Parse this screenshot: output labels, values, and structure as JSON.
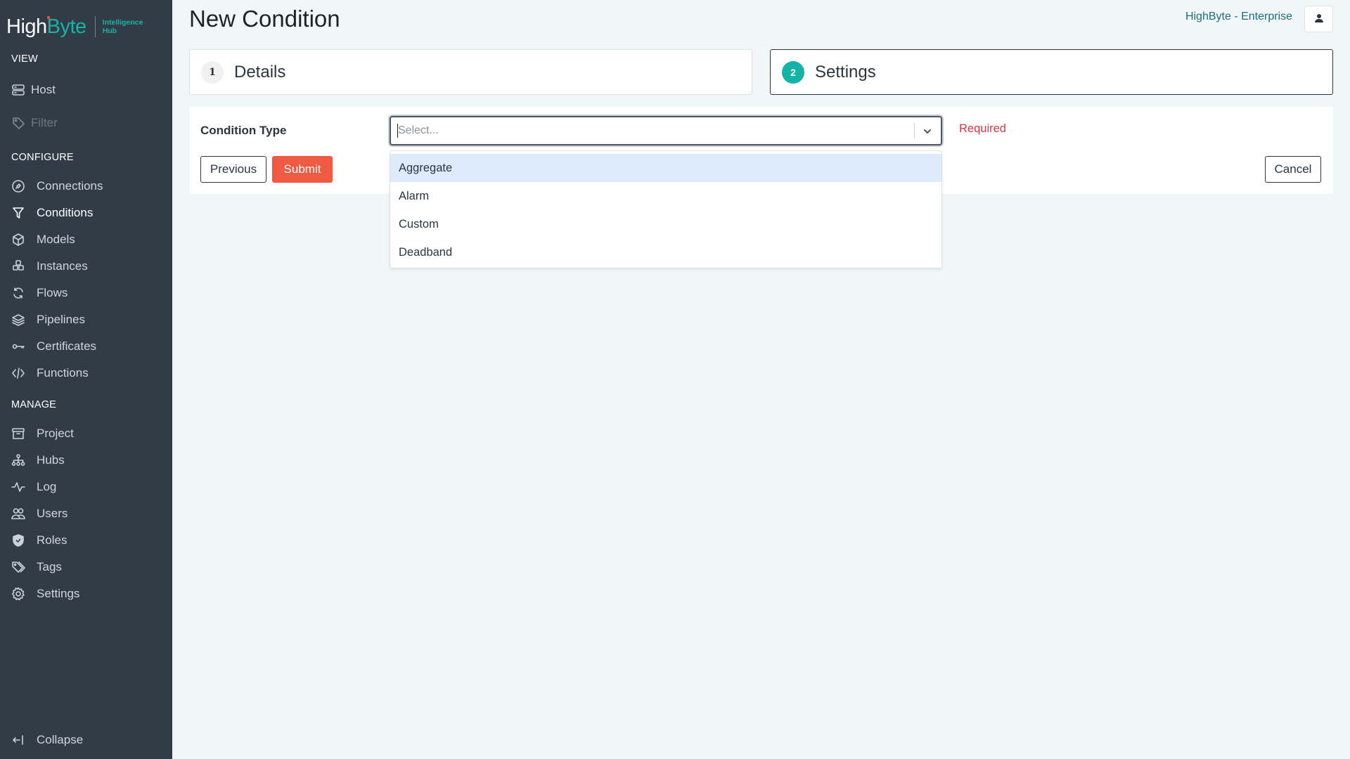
{
  "logo": {
    "brand_high": "High",
    "brand_byte": "Byte",
    "sub_line1": "Intelligence",
    "sub_line2": "Hub"
  },
  "sidebar": {
    "view_title": "VIEW",
    "view_items": [
      {
        "label": "Host",
        "icon": "server-icon"
      },
      {
        "label": "Filter",
        "icon": "tag-icon",
        "disabled": true
      }
    ],
    "configure_title": "CONFIGURE",
    "configure_items": [
      {
        "label": "Connections",
        "icon": "plug-icon"
      },
      {
        "label": "Conditions",
        "icon": "filter-icon",
        "active": true
      },
      {
        "label": "Models",
        "icon": "cube-icon"
      },
      {
        "label": "Instances",
        "icon": "cubes-icon"
      },
      {
        "label": "Flows",
        "icon": "refresh-icon"
      },
      {
        "label": "Pipelines",
        "icon": "layers-icon"
      },
      {
        "label": "Certificates",
        "icon": "key-icon"
      },
      {
        "label": "Functions",
        "icon": "code-icon"
      }
    ],
    "manage_title": "MANAGE",
    "manage_items": [
      {
        "label": "Project",
        "icon": "archive-icon"
      },
      {
        "label": "Hubs",
        "icon": "sitemap-icon"
      },
      {
        "label": "Log",
        "icon": "activity-icon"
      },
      {
        "label": "Users",
        "icon": "users-icon"
      },
      {
        "label": "Roles",
        "icon": "shield-icon"
      },
      {
        "label": "Tags",
        "icon": "tags-icon"
      },
      {
        "label": "Settings",
        "icon": "gear-icon"
      }
    ],
    "collapse_label": "Collapse"
  },
  "header": {
    "title": "New Condition",
    "org_name": "HighByte - Enterprise",
    "user_icon": "user-icon"
  },
  "steps": [
    {
      "number": "1",
      "label": "Details",
      "active": false
    },
    {
      "number": "2",
      "label": "Settings",
      "active": true
    }
  ],
  "form": {
    "field_label": "Condition Type",
    "select_placeholder": "Select...",
    "select_value": "",
    "validation": "Required",
    "options": [
      "Aggregate",
      "Alarm",
      "Custom",
      "Deadband"
    ],
    "focused_option": "Aggregate"
  },
  "buttons": {
    "previous": "Previous",
    "submit": "Submit",
    "cancel": "Cancel"
  },
  "colors": {
    "sidebar_bg": "#323c47",
    "brand_teal": "#14b3a6",
    "submit_red": "#f05a42",
    "required_red": "#dc3545",
    "option_highlight": "#deebfc"
  }
}
